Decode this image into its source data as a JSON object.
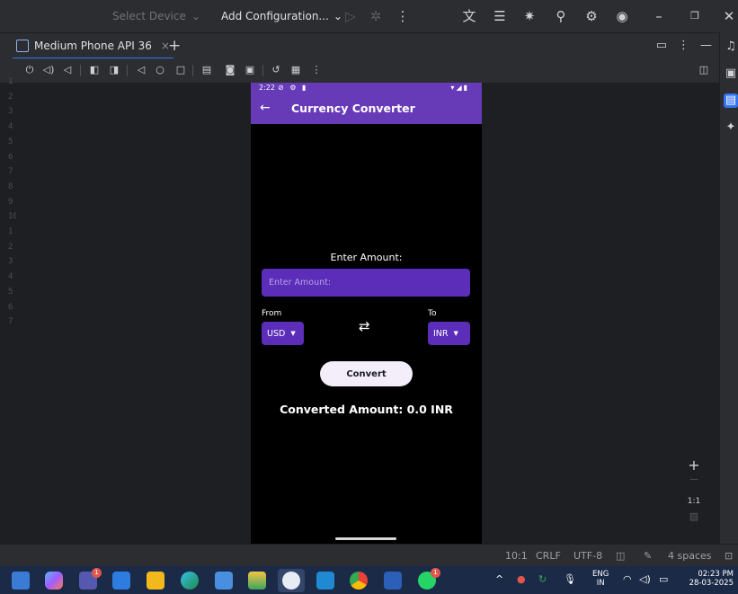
{
  "titlebar": {
    "device_select": "Select Device",
    "run_config": "Add Configuration..."
  },
  "emulator_tab": {
    "label": "Medium Phone API 36",
    "close": "×",
    "add": "+"
  },
  "gutter_lines": [
    "1",
    "2",
    "3",
    "4",
    "5",
    "6",
    "7",
    "8",
    "9",
    "10",
    "1",
    "2",
    "3",
    "4",
    "5",
    "6",
    "7"
  ],
  "phone": {
    "status_time": "2:22",
    "app_title": "Currency Converter",
    "enter_label": "Enter Amount:",
    "amount_placeholder": "Enter Amount:",
    "from_label": "From",
    "to_label": "To",
    "from_currency": "USD",
    "to_currency": "INR",
    "convert_label": "Convert",
    "result_text": "Converted Amount: 0.0 INR",
    "accent_color": "#673ab7"
  },
  "zoom": {
    "plus": "+",
    "minus": "—",
    "ratio": "1:1"
  },
  "ide_status": {
    "position": "10:1",
    "line_sep": "CRLF",
    "encoding": "UTF-8",
    "indent": "4 spaces"
  },
  "taskbar": {
    "teams_badge": "1",
    "whatsapp_badge": "1",
    "lang_line1": "ENG",
    "lang_line2": "IN",
    "time": "02:23 PM",
    "date": "28-03-2025"
  }
}
